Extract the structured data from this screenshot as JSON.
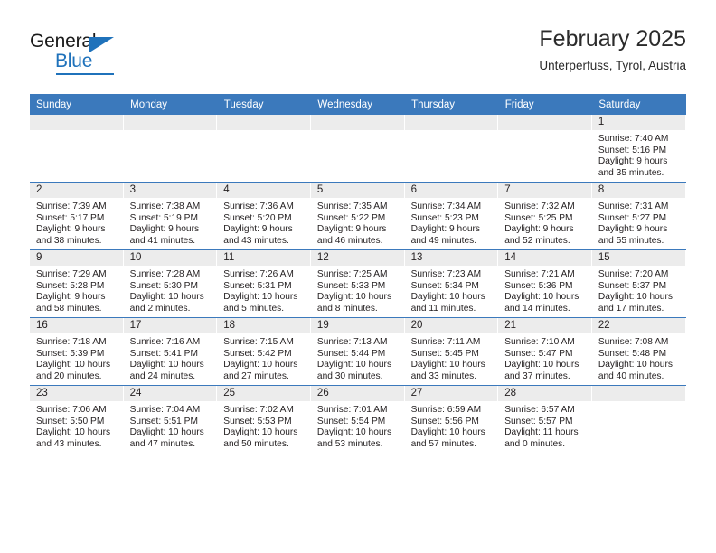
{
  "brand": {
    "name_top": "General",
    "name_bottom": "Blue",
    "accent_color": "#1f72bb"
  },
  "header": {
    "title": "February 2025",
    "subtitle": "Unterperfuss, Tyrol, Austria"
  },
  "theme": {
    "header_row_bg": "#3b79bc",
    "daynum_band_bg": "#ececec",
    "text_color": "#231f20",
    "page_bg": "#ffffff"
  },
  "weekdays": [
    "Sunday",
    "Monday",
    "Tuesday",
    "Wednesday",
    "Thursday",
    "Friday",
    "Saturday"
  ],
  "weeks": [
    [
      {
        "day": "",
        "empty": true,
        "sunrise": "",
        "sunset": "",
        "daylight1": "",
        "daylight2": ""
      },
      {
        "day": "",
        "empty": true,
        "sunrise": "",
        "sunset": "",
        "daylight1": "",
        "daylight2": ""
      },
      {
        "day": "",
        "empty": true,
        "sunrise": "",
        "sunset": "",
        "daylight1": "",
        "daylight2": ""
      },
      {
        "day": "",
        "empty": true,
        "sunrise": "",
        "sunset": "",
        "daylight1": "",
        "daylight2": ""
      },
      {
        "day": "",
        "empty": true,
        "sunrise": "",
        "sunset": "",
        "daylight1": "",
        "daylight2": ""
      },
      {
        "day": "",
        "empty": true,
        "sunrise": "",
        "sunset": "",
        "daylight1": "",
        "daylight2": ""
      },
      {
        "day": "1",
        "sunrise": "Sunrise: 7:40 AM",
        "sunset": "Sunset: 5:16 PM",
        "daylight1": "Daylight: 9 hours",
        "daylight2": "and 35 minutes."
      }
    ],
    [
      {
        "day": "2",
        "sunrise": "Sunrise: 7:39 AM",
        "sunset": "Sunset: 5:17 PM",
        "daylight1": "Daylight: 9 hours",
        "daylight2": "and 38 minutes."
      },
      {
        "day": "3",
        "sunrise": "Sunrise: 7:38 AM",
        "sunset": "Sunset: 5:19 PM",
        "daylight1": "Daylight: 9 hours",
        "daylight2": "and 41 minutes."
      },
      {
        "day": "4",
        "sunrise": "Sunrise: 7:36 AM",
        "sunset": "Sunset: 5:20 PM",
        "daylight1": "Daylight: 9 hours",
        "daylight2": "and 43 minutes."
      },
      {
        "day": "5",
        "sunrise": "Sunrise: 7:35 AM",
        "sunset": "Sunset: 5:22 PM",
        "daylight1": "Daylight: 9 hours",
        "daylight2": "and 46 minutes."
      },
      {
        "day": "6",
        "sunrise": "Sunrise: 7:34 AM",
        "sunset": "Sunset: 5:23 PM",
        "daylight1": "Daylight: 9 hours",
        "daylight2": "and 49 minutes."
      },
      {
        "day": "7",
        "sunrise": "Sunrise: 7:32 AM",
        "sunset": "Sunset: 5:25 PM",
        "daylight1": "Daylight: 9 hours",
        "daylight2": "and 52 minutes."
      },
      {
        "day": "8",
        "sunrise": "Sunrise: 7:31 AM",
        "sunset": "Sunset: 5:27 PM",
        "daylight1": "Daylight: 9 hours",
        "daylight2": "and 55 minutes."
      }
    ],
    [
      {
        "day": "9",
        "sunrise": "Sunrise: 7:29 AM",
        "sunset": "Sunset: 5:28 PM",
        "daylight1": "Daylight: 9 hours",
        "daylight2": "and 58 minutes."
      },
      {
        "day": "10",
        "sunrise": "Sunrise: 7:28 AM",
        "sunset": "Sunset: 5:30 PM",
        "daylight1": "Daylight: 10 hours",
        "daylight2": "and 2 minutes."
      },
      {
        "day": "11",
        "sunrise": "Sunrise: 7:26 AM",
        "sunset": "Sunset: 5:31 PM",
        "daylight1": "Daylight: 10 hours",
        "daylight2": "and 5 minutes."
      },
      {
        "day": "12",
        "sunrise": "Sunrise: 7:25 AM",
        "sunset": "Sunset: 5:33 PM",
        "daylight1": "Daylight: 10 hours",
        "daylight2": "and 8 minutes."
      },
      {
        "day": "13",
        "sunrise": "Sunrise: 7:23 AM",
        "sunset": "Sunset: 5:34 PM",
        "daylight1": "Daylight: 10 hours",
        "daylight2": "and 11 minutes."
      },
      {
        "day": "14",
        "sunrise": "Sunrise: 7:21 AM",
        "sunset": "Sunset: 5:36 PM",
        "daylight1": "Daylight: 10 hours",
        "daylight2": "and 14 minutes."
      },
      {
        "day": "15",
        "sunrise": "Sunrise: 7:20 AM",
        "sunset": "Sunset: 5:37 PM",
        "daylight1": "Daylight: 10 hours",
        "daylight2": "and 17 minutes."
      }
    ],
    [
      {
        "day": "16",
        "sunrise": "Sunrise: 7:18 AM",
        "sunset": "Sunset: 5:39 PM",
        "daylight1": "Daylight: 10 hours",
        "daylight2": "and 20 minutes."
      },
      {
        "day": "17",
        "sunrise": "Sunrise: 7:16 AM",
        "sunset": "Sunset: 5:41 PM",
        "daylight1": "Daylight: 10 hours",
        "daylight2": "and 24 minutes."
      },
      {
        "day": "18",
        "sunrise": "Sunrise: 7:15 AM",
        "sunset": "Sunset: 5:42 PM",
        "daylight1": "Daylight: 10 hours",
        "daylight2": "and 27 minutes."
      },
      {
        "day": "19",
        "sunrise": "Sunrise: 7:13 AM",
        "sunset": "Sunset: 5:44 PM",
        "daylight1": "Daylight: 10 hours",
        "daylight2": "and 30 minutes."
      },
      {
        "day": "20",
        "sunrise": "Sunrise: 7:11 AM",
        "sunset": "Sunset: 5:45 PM",
        "daylight1": "Daylight: 10 hours",
        "daylight2": "and 33 minutes."
      },
      {
        "day": "21",
        "sunrise": "Sunrise: 7:10 AM",
        "sunset": "Sunset: 5:47 PM",
        "daylight1": "Daylight: 10 hours",
        "daylight2": "and 37 minutes."
      },
      {
        "day": "22",
        "sunrise": "Sunrise: 7:08 AM",
        "sunset": "Sunset: 5:48 PM",
        "daylight1": "Daylight: 10 hours",
        "daylight2": "and 40 minutes."
      }
    ],
    [
      {
        "day": "23",
        "sunrise": "Sunrise: 7:06 AM",
        "sunset": "Sunset: 5:50 PM",
        "daylight1": "Daylight: 10 hours",
        "daylight2": "and 43 minutes."
      },
      {
        "day": "24",
        "sunrise": "Sunrise: 7:04 AM",
        "sunset": "Sunset: 5:51 PM",
        "daylight1": "Daylight: 10 hours",
        "daylight2": "and 47 minutes."
      },
      {
        "day": "25",
        "sunrise": "Sunrise: 7:02 AM",
        "sunset": "Sunset: 5:53 PM",
        "daylight1": "Daylight: 10 hours",
        "daylight2": "and 50 minutes."
      },
      {
        "day": "26",
        "sunrise": "Sunrise: 7:01 AM",
        "sunset": "Sunset: 5:54 PM",
        "daylight1": "Daylight: 10 hours",
        "daylight2": "and 53 minutes."
      },
      {
        "day": "27",
        "sunrise": "Sunrise: 6:59 AM",
        "sunset": "Sunset: 5:56 PM",
        "daylight1": "Daylight: 10 hours",
        "daylight2": "and 57 minutes."
      },
      {
        "day": "28",
        "sunrise": "Sunrise: 6:57 AM",
        "sunset": "Sunset: 5:57 PM",
        "daylight1": "Daylight: 11 hours",
        "daylight2": "and 0 minutes."
      },
      {
        "day": "",
        "empty": true,
        "sunrise": "",
        "sunset": "",
        "daylight1": "",
        "daylight2": ""
      }
    ]
  ]
}
